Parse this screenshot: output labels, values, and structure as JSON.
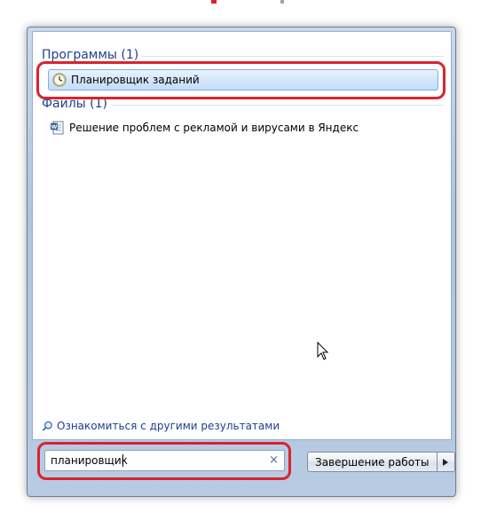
{
  "groups": {
    "programs": {
      "header": "Программы (1)",
      "items": [
        {
          "label": "Планировщик заданий",
          "icon": "clock-icon"
        }
      ]
    },
    "files": {
      "header": "Файлы (1)",
      "items": [
        {
          "label": "Решение проблем с рекламой и вирусами в Яндекс",
          "icon": "word-document-icon"
        }
      ]
    }
  },
  "see_more": {
    "label": "Ознакомиться с другими результатами",
    "icon": "magnifier-icon"
  },
  "search": {
    "value": "планировщик",
    "clear_label": "×"
  },
  "shutdown": {
    "label": "Завершение работы",
    "arrow_icon": "triangle-right-icon"
  },
  "colors": {
    "highlight": "#d9232d",
    "group_header": "#1e3e8e",
    "selection": "#c4ddfa"
  }
}
